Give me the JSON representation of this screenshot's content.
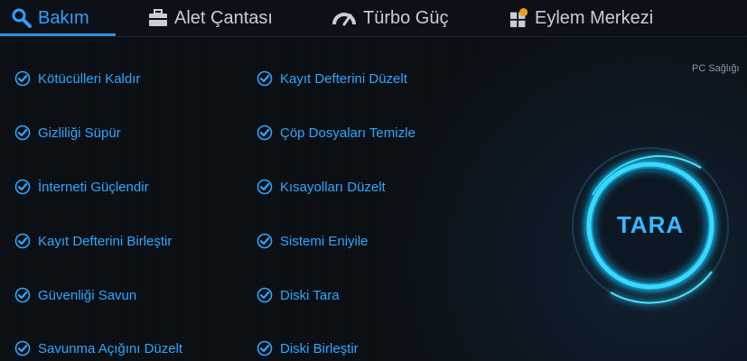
{
  "tabs": [
    {
      "label": "Bakım",
      "icon": "search-icon",
      "active": true
    },
    {
      "label": "Alet Çantası",
      "icon": "toolbox-icon",
      "active": false
    },
    {
      "label": "Türbo Güç",
      "icon": "speedometer-icon",
      "active": false
    },
    {
      "label": "Eylem Merkezi",
      "icon": "apps-grid-icon",
      "active": false,
      "badge": "1"
    }
  ],
  "left_items": [
    "Kötücülleri Kaldır",
    "Gizliliği Süpür",
    "İnterneti Güçlendir",
    "Kayıt Defterini Birleştir",
    "Güvenliği Savun",
    "Savunma Açığını Düzelt"
  ],
  "right_items": [
    "Kayıt Defterini Düzelt",
    "Çöp Dosyaları Temizle",
    "Kısayolları Düzelt",
    "Sistemi Eniyile",
    "Diski Tara",
    "Diski Birleştir"
  ],
  "health_label": "PC Sağlığı",
  "scan_button": "TARA",
  "colors": {
    "accent": "#2ea7ff",
    "glow": "#1fd0ff",
    "background": "#0b0f14",
    "tab_text": "#c9ced6",
    "badge": "#e8a21a"
  }
}
